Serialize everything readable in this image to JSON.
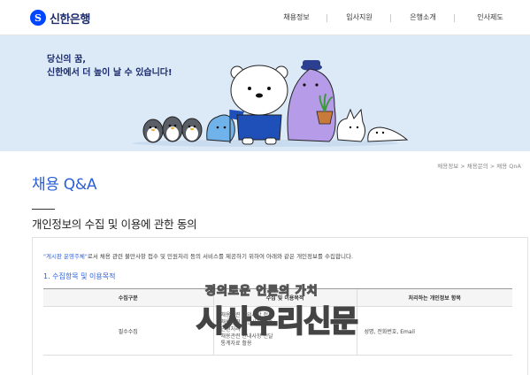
{
  "header": {
    "logo_text": "신한은행",
    "logo_mark": "S",
    "nav": [
      "채용정보",
      "입사지원",
      "은행소개",
      "인사제도"
    ]
  },
  "banner": {
    "line1": "당신의 꿈,",
    "line2": "신한에서 더 높이 날 수 있습니다!"
  },
  "breadcrumb": "채용정보 > 채용문의 > 채용 QnA",
  "page_title": "채용 Q&A",
  "section_title": "개인정보의 수집 및 이용에 관한 동의",
  "intro": {
    "quoted": "\"게시판 운영주체\"",
    "rest": "로서 채용 관련 불만사항 접수 및 민원처리 등의 서비스를 제공하기 위하여 아래와 같은 개인정보를 수집합니다."
  },
  "subhead": "1. 수집항목 및 이용목적",
  "table": {
    "headers": [
      "수집구분",
      "수집 및 이용목적",
      "처리하는 개인정보 항목"
    ],
    "rows": [
      {
        "category": "필수수집",
        "purposes": [
          "채용관련 문의사항 접수",
          "채용관련 불만사항 접수",
          "민원처리",
          "채용관련 안내사항 전달",
          "통계자료 활용"
        ],
        "items": "성명, 전화번호, Email"
      }
    ]
  },
  "watermark": {
    "top": "정의로운 언론의 가치",
    "main": "시사우리신문"
  },
  "colors": {
    "accent": "#2b5fd9",
    "banner_bg": "#dce9f6",
    "brand_navy": "#1a2a6c"
  }
}
